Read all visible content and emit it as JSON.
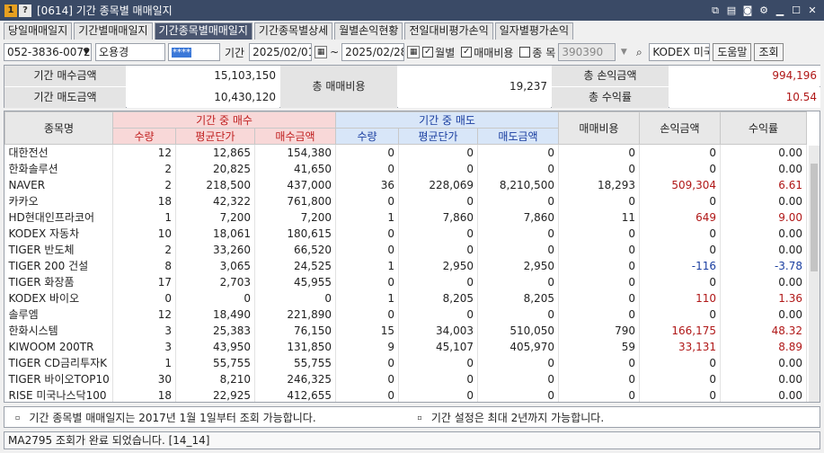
{
  "window": {
    "badge1": "1",
    "badge2": "?",
    "title": "[0614] 기간 종목별 매매일지"
  },
  "tabs": [
    {
      "label": "당일매매일지",
      "active": false
    },
    {
      "label": "기간별매매일지",
      "active": false
    },
    {
      "label": "기간종목별매매일지",
      "active": true
    },
    {
      "label": "기간종목별상세",
      "active": false
    },
    {
      "label": "월별손익현황",
      "active": false
    },
    {
      "label": "전일대비평가손익",
      "active": false
    },
    {
      "label": "일자별평가손익",
      "active": false
    }
  ],
  "toolbar": {
    "account": "052-3836-0072-0",
    "account_name": "오용경",
    "password_mask": "****",
    "period_label": "기간",
    "date_from": "2025/02/01",
    "tilde": "~",
    "date_to": "2025/02/28",
    "monthly_label": "월별",
    "monthly_checked": true,
    "trade_cost_label": "매매비용",
    "trade_cost_checked": true,
    "stock_label": "종 목",
    "stock_checked": false,
    "stock_code": "390390",
    "stock_name": "KODEX 미국",
    "help_label": "도움말",
    "search_label": "조회"
  },
  "summary": {
    "buy_amount_label": "기간 매수금액",
    "buy_amount": "15,103,150",
    "sell_amount_label": "기간 매도금액",
    "sell_amount": "10,430,120",
    "total_cost_label": "총 매매비용",
    "total_cost": "19,237",
    "total_pl_label": "총 손익금액",
    "total_pl": "994,196",
    "total_return_label": "총 수익률",
    "total_return": "10.54"
  },
  "grid": {
    "header": {
      "name": "종목명",
      "buy_group": "기간 중 매수",
      "sell_group": "기간 중 매도",
      "qty": "수량",
      "avg_price": "평균단가",
      "buy_amount": "매수금액",
      "sell_amount": "매도금액",
      "cost": "매매비용",
      "pl": "손익금액",
      "ret": "수익률"
    },
    "rows": [
      {
        "name": "대한전선",
        "bq": "12",
        "bp": "12,865",
        "ba": "154,380",
        "sq": "0",
        "sp": "0",
        "sa": "0",
        "cost": "0",
        "pl": "0",
        "ret": "0.00",
        "sign": "zero"
      },
      {
        "name": "한화솔루션",
        "bq": "2",
        "bp": "20,825",
        "ba": "41,650",
        "sq": "0",
        "sp": "0",
        "sa": "0",
        "cost": "0",
        "pl": "0",
        "ret": "0.00",
        "sign": "zero"
      },
      {
        "name": "NAVER",
        "bq": "2",
        "bp": "218,500",
        "ba": "437,000",
        "sq": "36",
        "sp": "228,069",
        "sa": "8,210,500",
        "cost": "18,293",
        "pl": "509,304",
        "ret": "6.61",
        "sign": "pos"
      },
      {
        "name": "카카오",
        "bq": "18",
        "bp": "42,322",
        "ba": "761,800",
        "sq": "0",
        "sp": "0",
        "sa": "0",
        "cost": "0",
        "pl": "0",
        "ret": "0.00",
        "sign": "zero"
      },
      {
        "name": "HD현대인프라코어",
        "bq": "1",
        "bp": "7,200",
        "ba": "7,200",
        "sq": "1",
        "sp": "7,860",
        "sa": "7,860",
        "cost": "11",
        "pl": "649",
        "ret": "9.00",
        "sign": "pos"
      },
      {
        "name": "KODEX 자동차",
        "bq": "10",
        "bp": "18,061",
        "ba": "180,615",
        "sq": "0",
        "sp": "0",
        "sa": "0",
        "cost": "0",
        "pl": "0",
        "ret": "0.00",
        "sign": "zero"
      },
      {
        "name": "TIGER 반도체",
        "bq": "2",
        "bp": "33,260",
        "ba": "66,520",
        "sq": "0",
        "sp": "0",
        "sa": "0",
        "cost": "0",
        "pl": "0",
        "ret": "0.00",
        "sign": "zero"
      },
      {
        "name": "TIGER 200 건설",
        "bq": "8",
        "bp": "3,065",
        "ba": "24,525",
        "sq": "1",
        "sp": "2,950",
        "sa": "2,950",
        "cost": "0",
        "pl": "-116",
        "ret": "-3.78",
        "sign": "neg"
      },
      {
        "name": "TIGER 화장품",
        "bq": "17",
        "bp": "2,703",
        "ba": "45,955",
        "sq": "0",
        "sp": "0",
        "sa": "0",
        "cost": "0",
        "pl": "0",
        "ret": "0.00",
        "sign": "zero"
      },
      {
        "name": "KODEX 바이오",
        "bq": "0",
        "bp": "0",
        "ba": "0",
        "sq": "1",
        "sp": "8,205",
        "sa": "8,205",
        "cost": "0",
        "pl": "110",
        "ret": "1.36",
        "sign": "pos"
      },
      {
        "name": "솔루엠",
        "bq": "12",
        "bp": "18,490",
        "ba": "221,890",
        "sq": "0",
        "sp": "0",
        "sa": "0",
        "cost": "0",
        "pl": "0",
        "ret": "0.00",
        "sign": "zero"
      },
      {
        "name": "한화시스템",
        "bq": "3",
        "bp": "25,383",
        "ba": "76,150",
        "sq": "15",
        "sp": "34,003",
        "sa": "510,050",
        "cost": "790",
        "pl": "166,175",
        "ret": "48.32",
        "sign": "pos"
      },
      {
        "name": "KIWOOM 200TR",
        "bq": "3",
        "bp": "43,950",
        "ba": "131,850",
        "sq": "9",
        "sp": "45,107",
        "sa": "405,970",
        "cost": "59",
        "pl": "33,131",
        "ret": "8.89",
        "sign": "pos"
      },
      {
        "name": "TIGER CD금리투자K",
        "bq": "1",
        "bp": "55,755",
        "ba": "55,755",
        "sq": "0",
        "sp": "0",
        "sa": "0",
        "cost": "0",
        "pl": "0",
        "ret": "0.00",
        "sign": "zero"
      },
      {
        "name": "TIGER 바이오TOP10",
        "bq": "30",
        "bp": "8,210",
        "ba": "246,325",
        "sq": "0",
        "sp": "0",
        "sa": "0",
        "cost": "0",
        "pl": "0",
        "ret": "0.00",
        "sign": "zero"
      },
      {
        "name": "RISE 미국나스닥100",
        "bq": "18",
        "bp": "22,925",
        "ba": "412,655",
        "sq": "0",
        "sp": "0",
        "sa": "0",
        "cost": "0",
        "pl": "0",
        "ret": "0.00",
        "sign": "zero"
      }
    ]
  },
  "info": {
    "note1": "기간 종목별 매매일지는 2017년 1월 1일부터 조회 가능합니다.",
    "note2": "기간 설정은 최대 2년까지 가능합니다."
  },
  "status": {
    "message": "MA2795 조회가 완료 되었습니다. [14_14]"
  }
}
